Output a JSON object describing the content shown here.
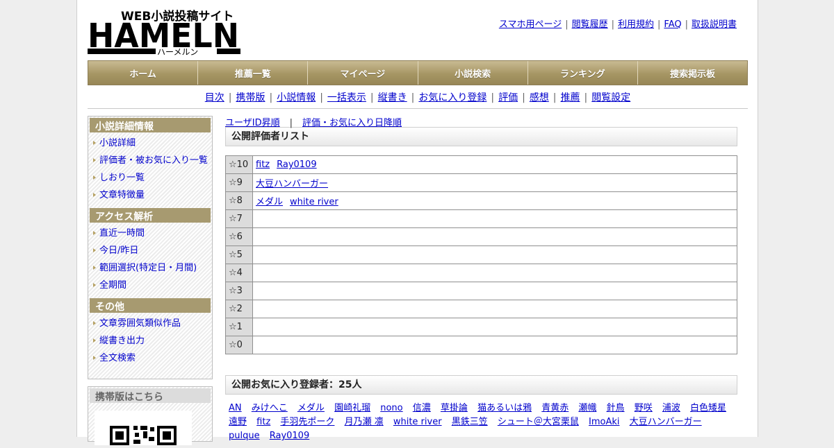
{
  "header": {
    "logo_main": "HAMELN",
    "logo_tag": "WEB小説投稿サイト",
    "logo_kana": "ハーメルン",
    "top_links": [
      "スマホ用ページ",
      "閲覧履歴",
      "利用規約",
      "FAQ",
      "取扱説明書"
    ]
  },
  "global_nav": [
    "ホーム",
    "推薦一覧",
    "マイページ",
    "小説検索",
    "ランキング",
    "捜索掲示板"
  ],
  "sub_nav": [
    "目次",
    "携帯版",
    "小説情報",
    "一括表示",
    "縦書き",
    "お気に入り登録",
    "評価",
    "感想",
    "推薦",
    "閲覧設定"
  ],
  "sidebar": {
    "sections": [
      {
        "title": "小説詳細情報",
        "items": [
          "小説詳細",
          "評価者・被お気に入り一覧",
          "しおり一覧",
          "文章特徴量"
        ]
      },
      {
        "title": "アクセス解析",
        "items": [
          "直近一時間",
          "今日/昨日",
          "範囲選択(特定日・月間)",
          "全期間"
        ]
      },
      {
        "title": "その他",
        "items": [
          "文章雰囲気類似作品",
          "縦書き出力",
          "全文検索"
        ]
      }
    ],
    "mobile_title": "携帯版はこちら"
  },
  "main": {
    "sort_links": [
      "ユーザID昇順",
      "評価・お気に入り日降順"
    ],
    "sort_separator": "|",
    "raters_title": "公開評価者リスト",
    "raters": [
      {
        "star": "☆10",
        "users": [
          "fitz",
          "Ray0109"
        ]
      },
      {
        "star": "☆9",
        "users": [
          "大豆ハンバーガー"
        ]
      },
      {
        "star": "☆8",
        "users": [
          "メダル",
          "white river"
        ]
      },
      {
        "star": "☆7",
        "users": []
      },
      {
        "star": "☆6",
        "users": []
      },
      {
        "star": "☆5",
        "users": []
      },
      {
        "star": "☆4",
        "users": []
      },
      {
        "star": "☆3",
        "users": []
      },
      {
        "star": "☆2",
        "users": []
      },
      {
        "star": "☆1",
        "users": []
      },
      {
        "star": "☆0",
        "users": []
      }
    ],
    "favorites_title": "公開お気に入り登録者：25人",
    "favorites": [
      "AN",
      "みけへこ",
      "メダル",
      "園崎礼瑠",
      "nono",
      "信濃",
      "草掛論",
      "猫あるいは鴉",
      "青黄赤",
      "瀬幟",
      "針鳥",
      "野咲",
      "浦波",
      "白色矮星",
      "遠野",
      "fitz",
      "手羽先ポーク",
      "月乃瀬 凛",
      "white river",
      "黒鉄三笠",
      "シュート＠大宮栗鼠",
      "ImoAki",
      "大豆ハンバーガー",
      "pulque",
      "Ray0109"
    ]
  },
  "colors": {
    "nav_gold": "#a69664",
    "sidebar_head": "#a79a70",
    "link": "#0000cc"
  }
}
